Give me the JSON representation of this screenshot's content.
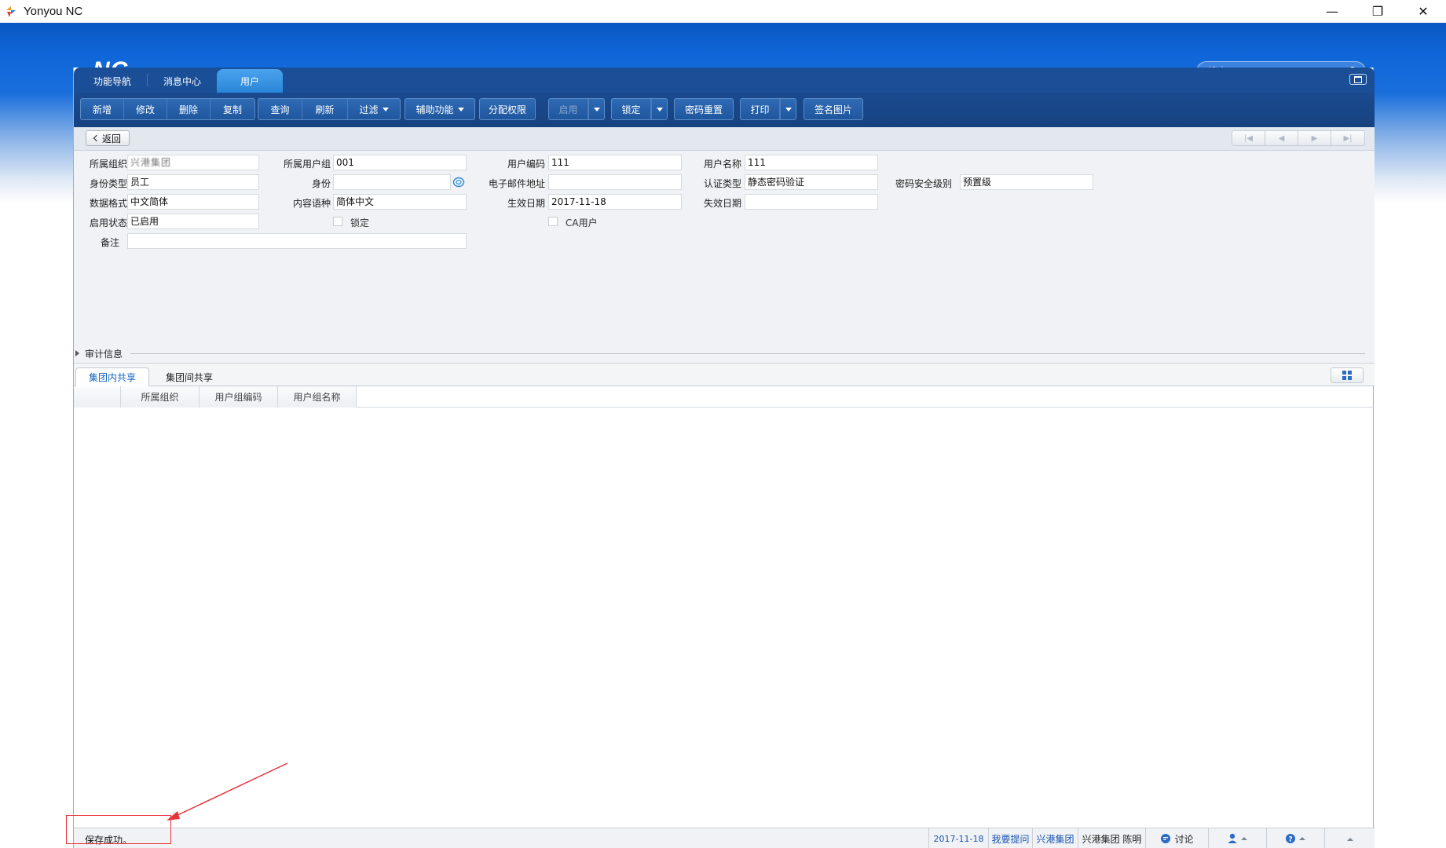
{
  "window": {
    "title": "Yonyou NC",
    "controls": {
      "minimize": "—",
      "restore": "❐",
      "close": "✕"
    }
  },
  "header": {
    "logo": "NC",
    "search_placeholder": "搜索"
  },
  "tabs": [
    {
      "label": "功能导航",
      "active": false
    },
    {
      "label": "消息中心",
      "active": false
    },
    {
      "label": "用户",
      "active": true
    }
  ],
  "toolbar": {
    "group1": [
      "新增",
      "修改",
      "删除",
      "复制"
    ],
    "group2": [
      "查询",
      "刷新",
      "过滤"
    ],
    "aux": "辅助功能",
    "assign": "分配权限",
    "enable": "启用",
    "lock": "锁定",
    "reset_password": "密码重置",
    "print": "打印",
    "signature": "签名图片"
  },
  "nav": {
    "back": "返回"
  },
  "form": {
    "org": {
      "label": "所属组织",
      "value": "兴港集团"
    },
    "user_group": {
      "label": "所属用户组",
      "value": "001"
    },
    "user_code": {
      "label": "用户编码",
      "value": "111"
    },
    "user_name": {
      "label": "用户名称",
      "value": "111"
    },
    "identity_type": {
      "label": "身份类型",
      "value": "员工"
    },
    "identity": {
      "label": "身份",
      "value": ""
    },
    "email": {
      "label": "电子邮件地址",
      "value": ""
    },
    "auth_type": {
      "label": "认证类型",
      "value": "静态密码验证"
    },
    "pwd_level": {
      "label": "密码安全级别",
      "value": "预置级"
    },
    "data_format": {
      "label": "数据格式",
      "value": "中文简体"
    },
    "content_lang": {
      "label": "内容语种",
      "value": "简体中文"
    },
    "effective_date": {
      "label": "生效日期",
      "value": "2017-11-18"
    },
    "expire_date": {
      "label": "失效日期",
      "value": ""
    },
    "enable_status": {
      "label": "启用状态",
      "value": "已启用"
    },
    "locked": {
      "label": "锁定",
      "checked": false
    },
    "ca_user": {
      "label": "CA用户",
      "checked": false
    },
    "remark": {
      "label": "备注",
      "value": ""
    },
    "audit": "审计信息"
  },
  "subtabs": [
    {
      "label": "集团内共享",
      "active": true
    },
    {
      "label": "集团间共享",
      "active": false
    }
  ],
  "table": {
    "columns": [
      "所属组织",
      "用户组编码",
      "用户组名称"
    ]
  },
  "statusbar": {
    "message": "保存成功。",
    "date": "2017-11-18",
    "ask": "我要提问",
    "group": "兴港集团",
    "user": "兴港集团  陈明",
    "discuss": "讨论"
  },
  "colors": {
    "header_blue": "#0f66d8",
    "toolbar_blue": "#1a4a8f",
    "active_tab": "#2a86d8",
    "annotation_red": "#e8323a"
  }
}
